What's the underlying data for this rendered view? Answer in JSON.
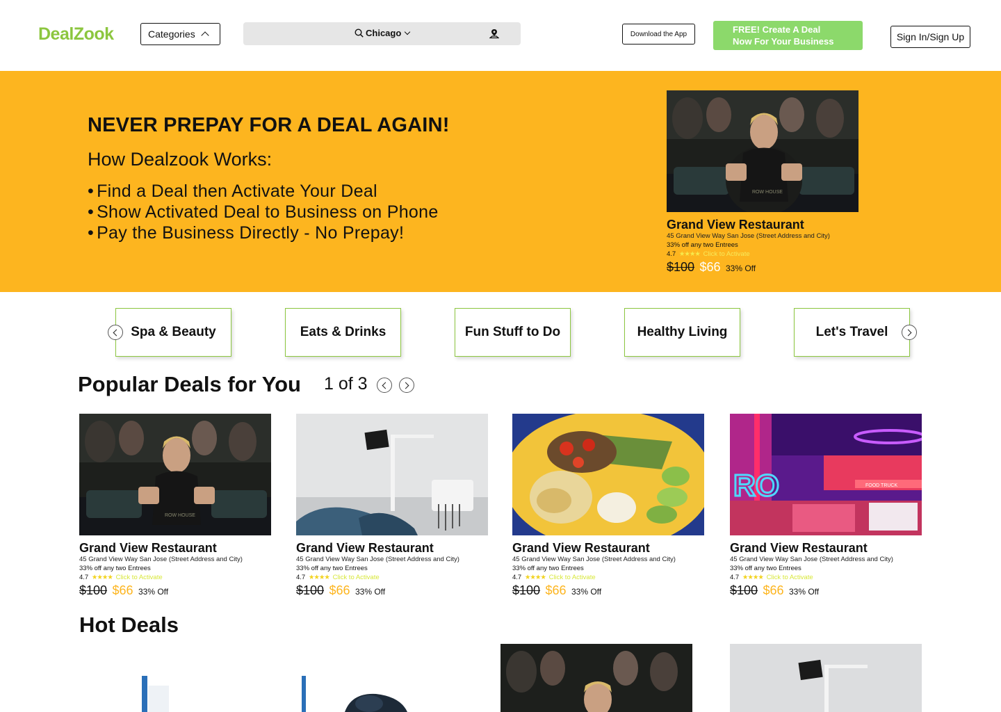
{
  "header": {
    "logo_text": "DealZook",
    "categories_label": "Categories",
    "location": "Chicago",
    "download_label": "Download the App",
    "create_deal_line1": "FREE! Create A Deal",
    "create_deal_line2": "Now For Your Business",
    "signin_label": "Sign In/Sign Up"
  },
  "hero": {
    "title": "NEVER PREPAY FOR A DEAL AGAIN!",
    "subtitle": "How Dealzook Works:",
    "steps": [
      "Find a Deal then Activate Your Deal",
      "Show Activated Deal to Business on Phone",
      "Pay the Business Directly - No Prepay!"
    ],
    "featured": {
      "name": "Grand View Restaurant",
      "address": "45 Grand View Way San Jose (Street Address and City)",
      "offer": "33% off any two Entrees",
      "rating": "4.7",
      "stars": "★★★★",
      "activate": "Click to Activate",
      "old_price": "$100",
      "new_price": "$66",
      "discount": "33% Off"
    }
  },
  "categories": [
    "Spa & Beauty",
    "Eats & Drinks",
    "Fun Stuff to Do",
    "Healthy Living",
    "Let's Travel"
  ],
  "popular": {
    "title": "Popular Deals for You",
    "pager": "1 of 3",
    "deals": [
      {
        "name": "Grand View Restaurant",
        "address": "45 Grand View Way San Jose (Street Address and City)",
        "offer": "33% off any two Entrees",
        "rating": "4.7",
        "stars": "★★★★",
        "activate": "Click to Activate",
        "old_price": "$100",
        "new_price": "$66",
        "discount": "33% Off",
        "image": "rowing-gym"
      },
      {
        "name": "Grand View Restaurant",
        "address": "45 Grand View Way San Jose (Street Address and City)",
        "offer": "33% off any two Entrees",
        "rating": "4.7",
        "stars": "★★★★",
        "activate": "Click to Activate",
        "old_price": "$100",
        "new_price": "$66",
        "discount": "33% Off",
        "image": "dental-chair"
      },
      {
        "name": "Grand View Restaurant",
        "address": "45 Grand View Way San Jose (Street Address and City)",
        "offer": "33% off any two Entrees",
        "rating": "4.7",
        "stars": "★★★★",
        "activate": "Click to Activate",
        "old_price": "$100",
        "new_price": "$66",
        "discount": "33% Off",
        "image": "food-plate"
      },
      {
        "name": "Grand View Restaurant",
        "address": "45 Grand View Way San Jose (Street Address and City)",
        "offer": "33% off any two Entrees",
        "rating": "4.7",
        "stars": "★★★★",
        "activate": "Click to Activate",
        "old_price": "$100",
        "new_price": "$66",
        "discount": "33% Off",
        "image": "neon-venue"
      }
    ]
  },
  "hot": {
    "title": "Hot Deals"
  },
  "colors": {
    "brand_green": "#8cc63f",
    "hero_yellow": "#fdb51f",
    "button_green": "#8cd96b",
    "star_yellow": "#f2d31f"
  }
}
